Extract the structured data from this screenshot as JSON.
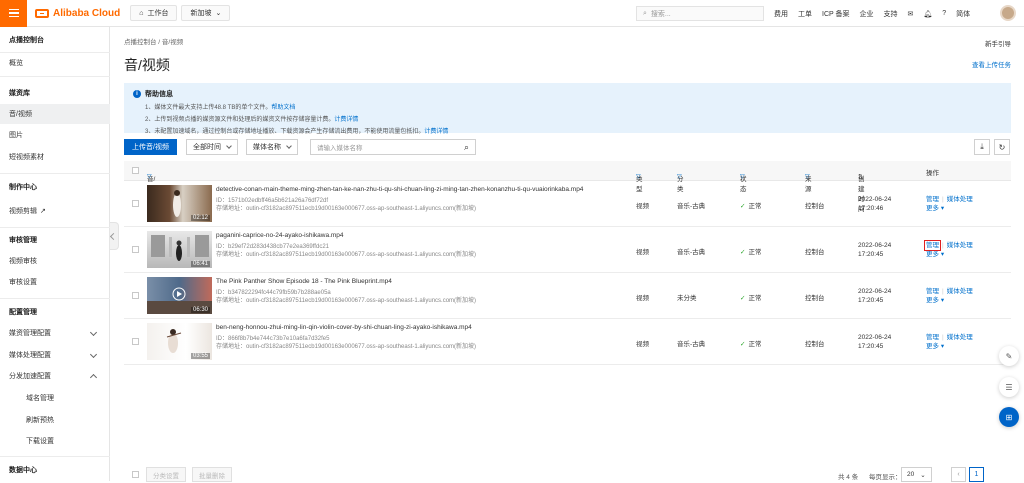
{
  "topbar": {
    "brand": "Alibaba Cloud",
    "workbench": "工作台",
    "region": "新加坡",
    "search_placeholder": "搜索...",
    "links": [
      "费用",
      "工单",
      "ICP 备案",
      "企业",
      "支持"
    ],
    "lang": "简体"
  },
  "sidebar": {
    "title": "点播控制台",
    "overview": "概览",
    "media_library": "媒资库",
    "audio_video": "音/视频",
    "images": "图片",
    "short_video_materials": "短视频素材",
    "production_center": "制作中心",
    "video_editing": "视频剪辑",
    "review_management": "审核管理",
    "video_review": "视频审核",
    "review_settings": "审核设置",
    "config_management": "配置管理",
    "media_mgmt_config": "媒资管理配置",
    "media_processing_config": "媒体处理配置",
    "distribution_accel_config": "分发加速配置",
    "domain_management": "域名管理",
    "refresh_preload": "刷新预热",
    "download_settings": "下载设置",
    "data_center": "数据中心"
  },
  "main": {
    "breadcrumb": "点播控制台 / 音/视频",
    "newbie_guide": "新手引导",
    "page_title": "音/视频",
    "view_upload_tasks": "查看上传任务",
    "help": {
      "title": "帮助信息",
      "line1": "1、媒体文件最大支持上传48.8 TB的单个文件。",
      "line1_link": "帮助文档",
      "line2": "2、上传到视频点播的媒资源文件和处理后的媒资文件按存储容量计费。",
      "line2_link": "计费详情",
      "line3": "3、未配置加速域名，通过控制台或存储地址播放、下载资源会产生存储流出费用，不能使用流量包抵扣。",
      "line3_link": "计费详情"
    },
    "filters": {
      "upload_button": "上传音/视频",
      "time_select": "全部时间",
      "field_select": "媒体名称",
      "search_placeholder": "请输入媒体名称"
    },
    "table": {
      "headers": {
        "media": "音/视频",
        "type": "类型",
        "category": "分类",
        "status": "状态",
        "source": "来源",
        "created": "创建时间",
        "actions": "操作"
      },
      "rows": [
        {
          "name": "detective-conan-main-theme-ming-zhen-tan-ke-nan-zhu-ti-qu-shi-chuan-ling-zi-ming-tan-zhen-konanzhu-ti-qu-vuaiorinkaba.mp4",
          "id": "ID：1571b02edbff46a5b621a26a76df72df",
          "path": "存储地址：outin-cf3182ac897511ecb19d00163e000677.oss-ap-southeast-1.aliyuncs.com(新加坡)",
          "duration": "02:12",
          "type": "视频",
          "category": "音乐-古典",
          "status": "正常",
          "source": "控制台",
          "date": "2022-06-24",
          "time": "17:20:46"
        },
        {
          "name": "paganini-caprice-no-24-ayako-ishikawa.mp4",
          "id": "ID：b29ef72d283d438cb77e2ea369ffdc21",
          "path": "存储地址：outin-cf3182ac897511ecb19d00163e000677.oss-ap-southeast-1.aliyuncs.com(新加坡)",
          "duration": "06:41",
          "type": "视频",
          "category": "音乐-古典",
          "status": "正常",
          "source": "控制台",
          "date": "2022-06-24",
          "time": "17:20:45"
        },
        {
          "name": "The Pink Panther Show Episode 18 - The Pink Blueprint.mp4",
          "id": "ID：b347822294fc44c79fb59b7b288ae05a",
          "path": "存储地址：outin-cf3182ac897511ecb19d00163e000677.oss-ap-southeast-1.aliyuncs.com(新加坡)",
          "duration": "06:30",
          "type": "视频",
          "category": "未分类",
          "status": "正常",
          "source": "控制台",
          "date": "2022-06-24",
          "time": "17:20:45"
        },
        {
          "name": "ben-neng-honnou-zhui-ming-lin-qin-violin-cover-by-shi-chuan-ling-zi-ayako-ishikawa.mp4",
          "id": "ID：866f8b7b4e744c73b7e10a6fa7d32fe5",
          "path": "存储地址：outin-cf3182ac897511ecb19d00163e000677.oss-ap-southeast-1.aliyuncs.com(新加坡)",
          "duration": "03:55",
          "type": "视频",
          "category": "音乐-古典",
          "status": "正常",
          "source": "控制台",
          "date": "2022-06-24",
          "time": "17:20:45"
        }
      ],
      "action_manage": "管理",
      "action_process": "媒体处理",
      "action_more": "更多"
    },
    "footer": {
      "btn_batch_category": "分类设置",
      "btn_batch_delete": "批量删除",
      "total": "共 4 条",
      "per_page_label": "每页显示：",
      "per_page": "20",
      "current_page": "1"
    }
  }
}
